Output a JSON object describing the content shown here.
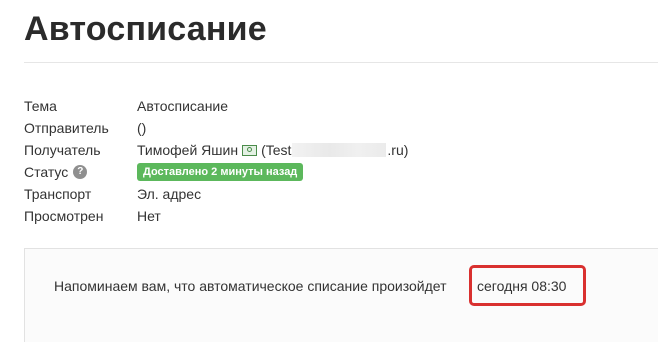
{
  "page": {
    "title": "Автосписание"
  },
  "meta": {
    "rows": [
      {
        "label": "Тема",
        "value": "Автосписание"
      },
      {
        "label": "Отправитель",
        "value": "()"
      },
      {
        "label": "Получатель",
        "value_name": "Тимофей Яшин",
        "value_open": "(Test",
        "value_close": ".ru)"
      },
      {
        "label": "Статус",
        "badge": "Доставлено 2 минуты назад"
      },
      {
        "label": "Транспорт",
        "value": "Эл. адрес"
      },
      {
        "label": "Просмотрен",
        "value": "Нет"
      }
    ]
  },
  "message": {
    "text": "Напоминаем вам, что автоматическое списание произойдет",
    "highlight": "сегодня 08:30"
  },
  "colors": {
    "badge": "#5cb85c",
    "highlight_border": "#d9302f"
  },
  "icons": {
    "status_help": "question-circle-icon",
    "recipient": "money-icon"
  }
}
